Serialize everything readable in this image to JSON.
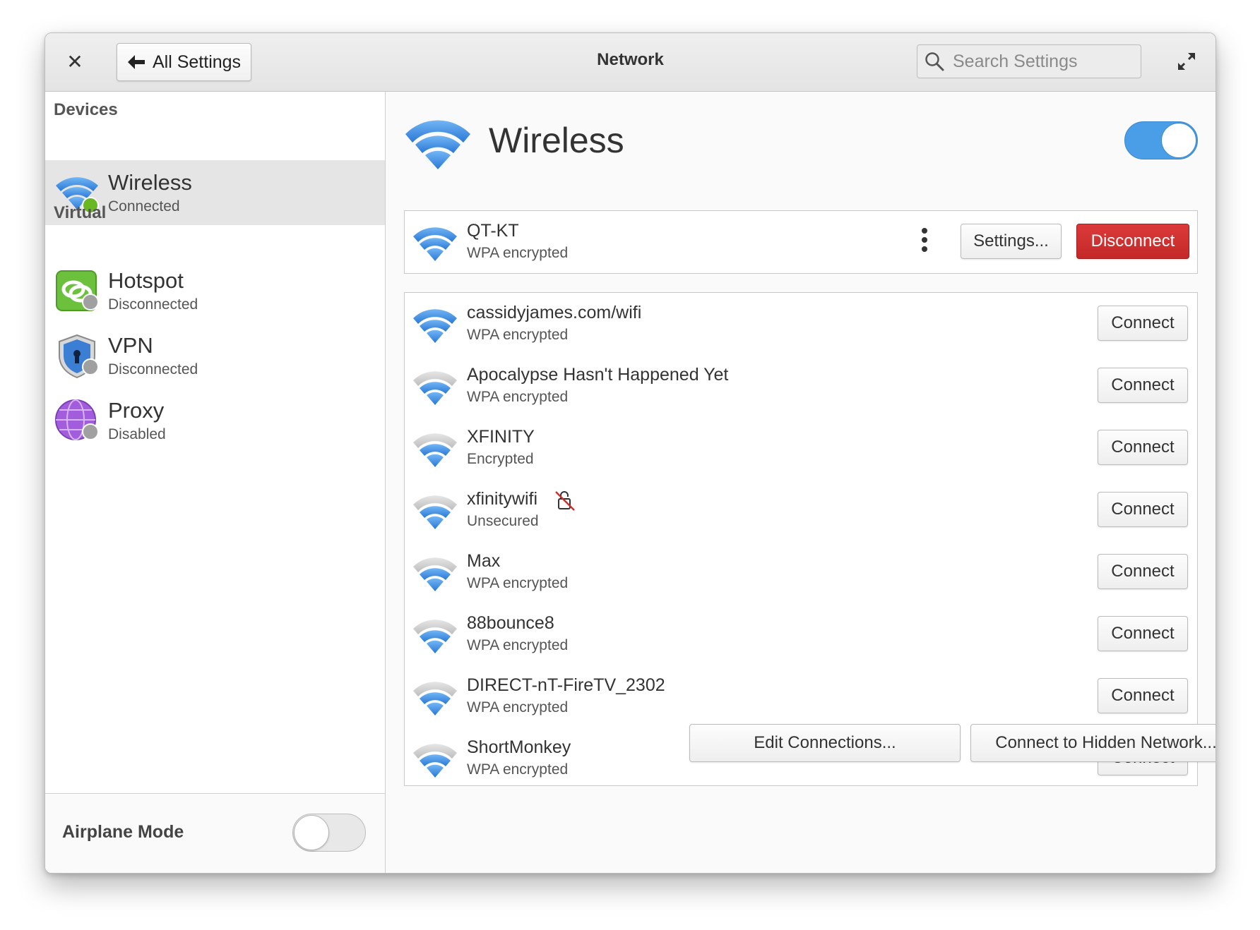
{
  "window": {
    "title": "Network",
    "back_label": "All Settings",
    "search_placeholder": "Search Settings"
  },
  "sidebar": {
    "devices_header": "Devices",
    "virtual_header": "Virtual",
    "items": [
      {
        "name": "Wireless",
        "status": "Connected",
        "status_color": "#68b723",
        "selected": true
      },
      {
        "name": "Hotspot",
        "status": "Disconnected",
        "status_color": "#a0a0a0"
      },
      {
        "name": "VPN",
        "status": "Disconnected",
        "status_color": "#a0a0a0"
      },
      {
        "name": "Proxy",
        "status": "Disabled",
        "status_color": "#a0a0a0"
      }
    ],
    "airplane_label": "Airplane Mode",
    "airplane_enabled": false
  },
  "main": {
    "title": "Wireless",
    "wireless_enabled": true,
    "connected": {
      "name": "QT-KT",
      "security": "WPA encrypted",
      "settings_label": "Settings...",
      "disconnect_label": "Disconnect"
    },
    "networks": [
      {
        "name": "cassidyjames.com/wifi",
        "security": "WPA encrypted",
        "connect_label": "Connect",
        "signal": "full"
      },
      {
        "name": "Apocalypse Hasn't Happened Yet",
        "security": "WPA encrypted",
        "connect_label": "Connect",
        "signal": "good"
      },
      {
        "name": "XFINITY",
        "security": "Encrypted",
        "connect_label": "Connect",
        "signal": "good"
      },
      {
        "name": "xfinitywifi",
        "security": "Unsecured",
        "connect_label": "Connect",
        "signal": "good",
        "insecure_icon": "unlocked-icon"
      },
      {
        "name": "Max",
        "security": "WPA encrypted",
        "connect_label": "Connect",
        "signal": "good"
      },
      {
        "name": "88bounce8",
        "security": "WPA encrypted",
        "connect_label": "Connect",
        "signal": "good"
      },
      {
        "name": "DIRECT-nT-FireTV_2302",
        "security": "WPA encrypted",
        "connect_label": "Connect",
        "signal": "good"
      },
      {
        "name": "ShortMonkey",
        "security": "WPA encrypted",
        "connect_label": "Connect",
        "signal": "good"
      }
    ],
    "edit_connections_label": "Edit Connections...",
    "hidden_network_label": "Connect to Hidden Network..."
  },
  "colors": {
    "accent": "#4a9ee8",
    "danger": "#c92a2a",
    "wifi_blue": "#3689e6",
    "wifi_gray": "#c8c8c8"
  }
}
